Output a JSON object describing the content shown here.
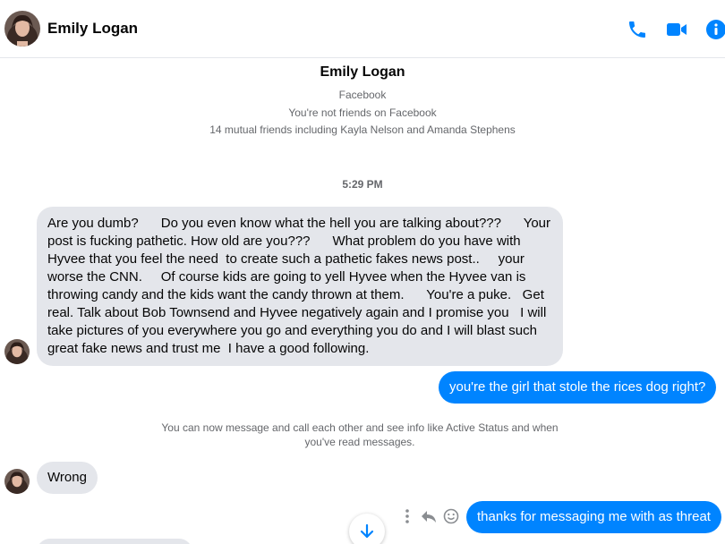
{
  "header": {
    "contact_name": "Emily Logan",
    "icons": [
      "avatar",
      "phone-icon",
      "video-camera-icon",
      "info-icon"
    ],
    "accent_color": "#0084ff"
  },
  "profile": {
    "name": "Emily Logan",
    "platform": "Facebook",
    "friend_status": "You're not friends on Facebook",
    "mutual_friends": "14 mutual friends including Kayla Nelson and Amanda Stephens"
  },
  "conversation": {
    "timestamp": "5:29 PM",
    "messages": [
      {
        "sender": "contact",
        "lines": [
          "Are you dumb?      Do you even know what the hell you are talking about???      Your",
          "post is fucking pathetic. How old are you???      What problem do you have with",
          "Hyvee that you feel the need  to create such a pathetic fakes news post..     your",
          "worse the CNN.     Of course kids are going to yell Hyvee when the Hyvee van is",
          "throwing candy and the kids want the candy thrown at them.      You're a puke.   Get",
          "real. Talk about Bob Townsend and Hyvee negatively again and I promise you   I will",
          "take pictures of you everywhere you go and everything you do and I will blast such",
          "great fake news and trust me  I have a good following."
        ]
      },
      {
        "sender": "me",
        "text": "you're the girl that stole the rices dog right?"
      },
      {
        "sender": "system",
        "text": "You can now message and call each other and see info like Active Status and when you've read messages."
      },
      {
        "sender": "contact",
        "text": "Wrong"
      },
      {
        "sender": "me",
        "text": "thanks for messaging me with as threat"
      }
    ]
  },
  "message_actions": [
    "more-options-icon",
    "reply-icon",
    "emoji-react-icon"
  ],
  "scroll_button": {
    "icon": "arrow-down-icon"
  }
}
